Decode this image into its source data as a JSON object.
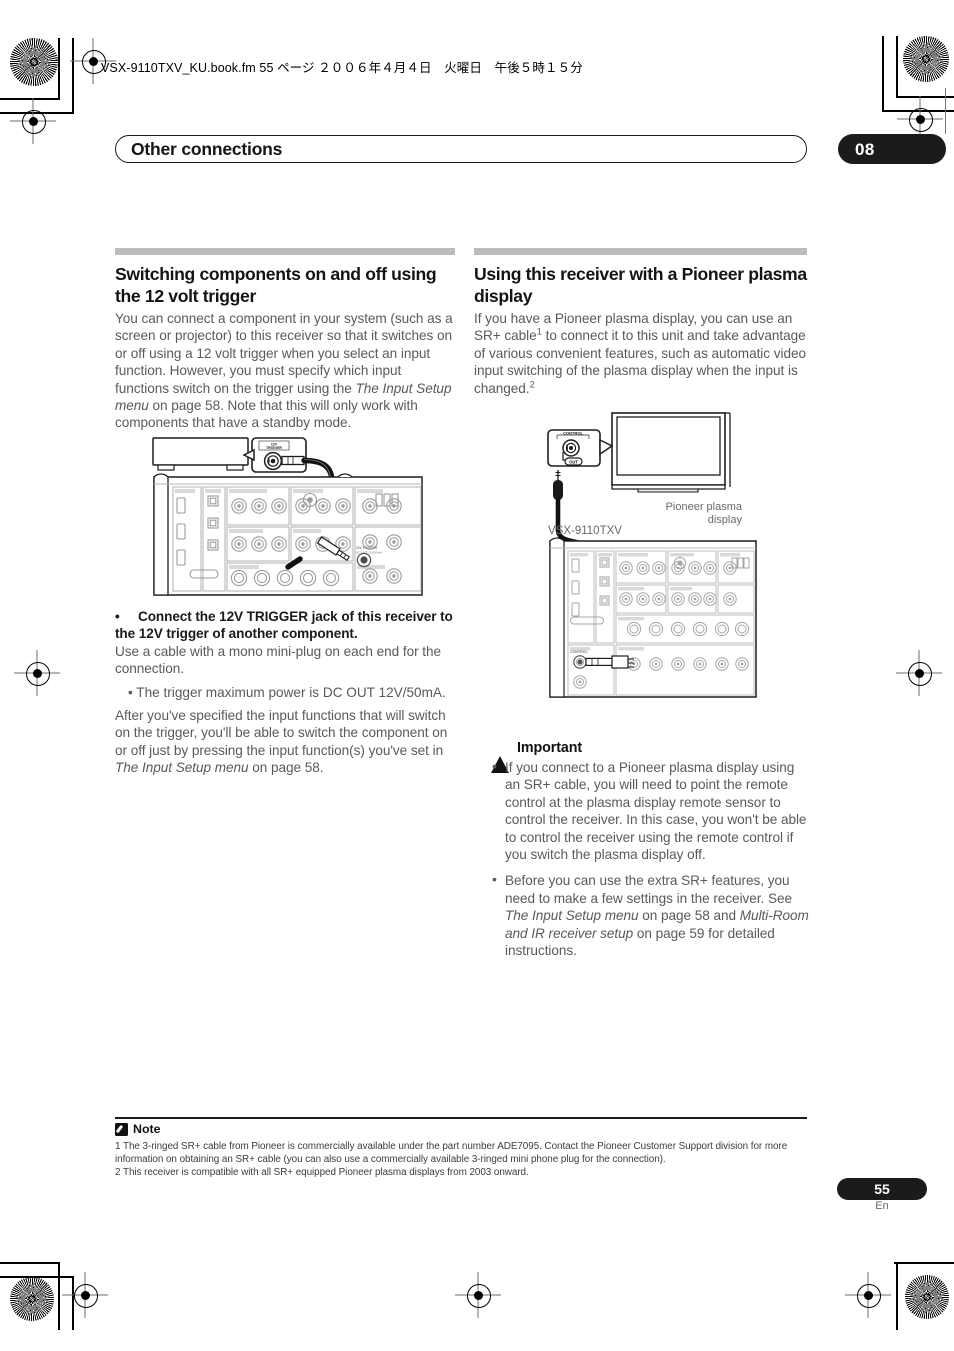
{
  "page": {
    "file_header": "VSX-9110TXV_KU.book.fm 55 ページ ２００６年４月４日　火曜日　午後５時１５分",
    "chapter_title": "Other connections",
    "chapter_number": "08",
    "page_number": "55",
    "page_language": "En"
  },
  "left_column": {
    "heading": "Switching components on and off using the 12 volt trigger",
    "intro_part1": "You can connect a component in your system (such as a screen or projector) to this receiver so that it switches on or off using a 12 volt trigger when you select an input function. However, you must specify which input functions switch on the trigger using the ",
    "intro_italic": "The Input Setup menu",
    "intro_part2": " on page 58. Note that this will only work with components that have a standby mode.",
    "bullet_bold": "Connect the 12V TRIGGER jack of this receiver to the 12V trigger of another component.",
    "after_bullet": "Use a cable with a mono mini-plug on each end for the connection.",
    "sub_bullet": "The trigger maximum power is DC OUT 12V/50mA.",
    "closing_part1": "After you've specified the input functions that will switch on the trigger, you'll be able to switch the component on or off just by pressing the input function(s) you've set in ",
    "closing_italic": "The Input Setup menu",
    "closing_part2": " on page 58.",
    "diagram": {
      "callout_label_line1": "12V",
      "callout_label_line2": "TRIGGER",
      "panel_jack_label": "12V TRIGGER DC OUT 12V/50mA"
    }
  },
  "right_column": {
    "heading": "Using this receiver with a Pioneer plasma display",
    "intro_part1": "If you have a Pioneer plasma display, you can use an SR+ cable",
    "intro_sup1": "1",
    "intro_part2": " to connect it to this unit and take advantage of various convenient features, such as automatic video input switching of the plasma display when the input is changed.",
    "intro_sup2": "2",
    "diagram": {
      "callout_label": "CONTROL",
      "callout_sub_label": "OUT",
      "display_label_line1": "Pioneer plasma",
      "display_label_line2": "display",
      "receiver_label": "VSX-9110TXV",
      "panel_control_label": "CONTROL"
    },
    "important": {
      "title": "Important",
      "items": [
        "If you connect to a Pioneer plasma display using an SR+ cable, you will need to point the remote control at the plasma display remote sensor to control the receiver. In this case, you won't be able to control the receiver using the remote control if you switch the plasma display off.",
        "Before you can use the extra SR+ features, you need to make a few settings in the receiver. See The Input Setup menu on page 58 and Multi-Room and IR receiver setup on page 59 for detailed instructions."
      ],
      "item2_part1": "Before you can use the extra SR+ features, you need to make a few settings in the receiver. See ",
      "item2_italic1": "The Input Setup menu",
      "item2_part2": " on page 58 and ",
      "item2_italic2": "Multi-Room and IR receiver setup",
      "item2_part3": " on page 59 for detailed instructions."
    }
  },
  "notes": {
    "label": "Note",
    "footnote_1": "1 The 3-ringed SR+ cable from Pioneer is commercially available under the part number ADE7095. Contact the Pioneer Customer Support division for more information on obtaining an SR+ cable (you can also use a commercially available 3-ringed mini phone plug for the connection).",
    "footnote_2": "2 This receiver is compatible with all SR+ equipped Pioneer plasma displays from 2003 onward."
  },
  "colors": {
    "accent_dark": "#1b1b1b",
    "rule_gray": "#bcbcbc",
    "body_gray": "#5a5a5a"
  }
}
